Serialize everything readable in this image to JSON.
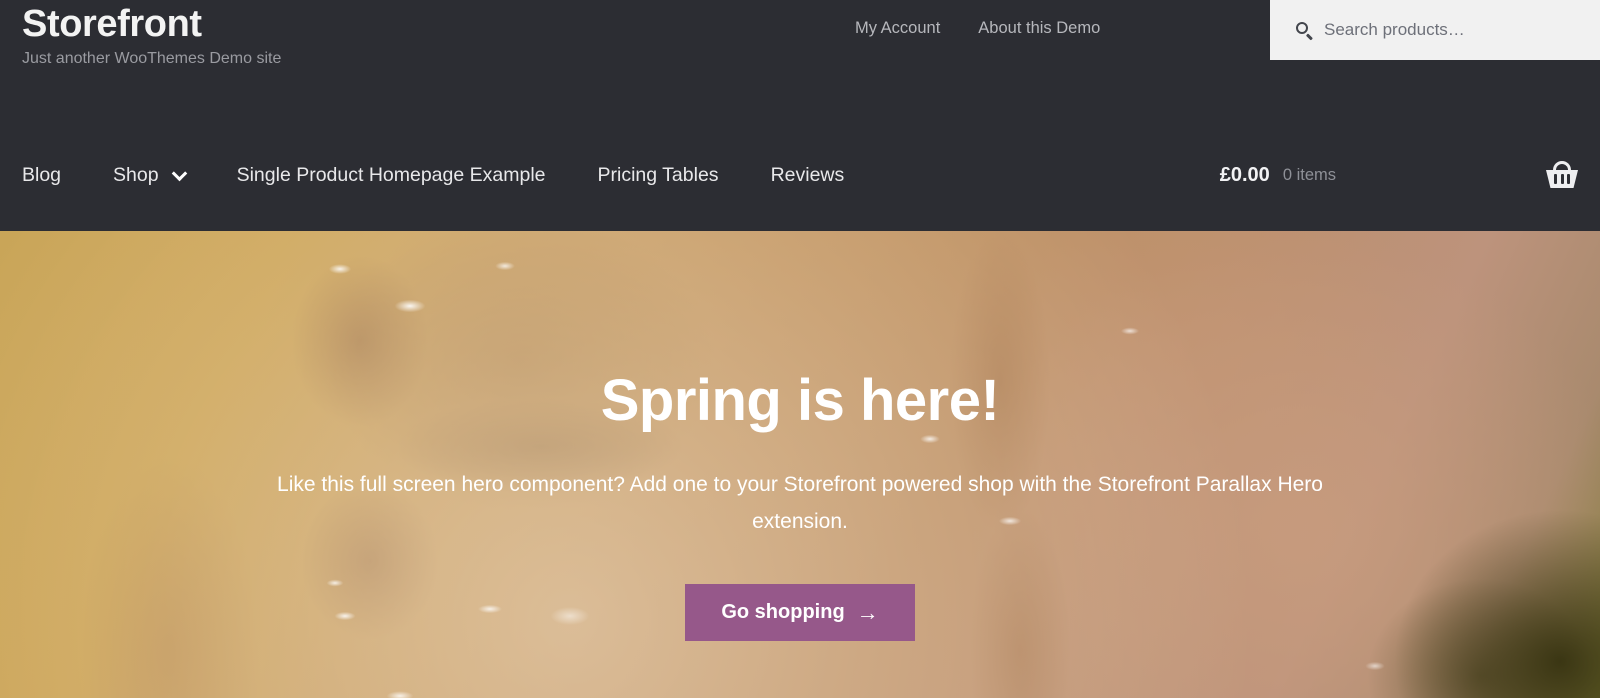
{
  "header": {
    "site_title": "Storefront",
    "tagline": "Just another WooThemes Demo site",
    "secondary_nav": [
      {
        "label": "My Account"
      },
      {
        "label": "About this Demo"
      }
    ],
    "search": {
      "placeholder": "Search products…",
      "value": "",
      "icon": "search-icon"
    }
  },
  "main_nav": {
    "items": [
      {
        "label": "Blog",
        "has_dropdown": false
      },
      {
        "label": "Shop",
        "has_dropdown": true
      },
      {
        "label": "Single Product Homepage Example",
        "has_dropdown": false
      },
      {
        "label": "Pricing Tables",
        "has_dropdown": false
      },
      {
        "label": "Reviews",
        "has_dropdown": false
      }
    ],
    "cart": {
      "amount": "£0.00",
      "count": "0 items",
      "icon": "shopping-basket-icon"
    }
  },
  "hero": {
    "title": "Spring is here!",
    "description": "Like this full screen hero component? Add one to your Storefront powered shop with the Storefront Parallax Hero extension.",
    "button_label": "Go shopping",
    "button_arrow": "→"
  },
  "colors": {
    "header_background": "#2c2d33",
    "accent_purple": "#96588a",
    "search_background": "#f1f1f1",
    "muted_text": "#9a9ba1"
  }
}
